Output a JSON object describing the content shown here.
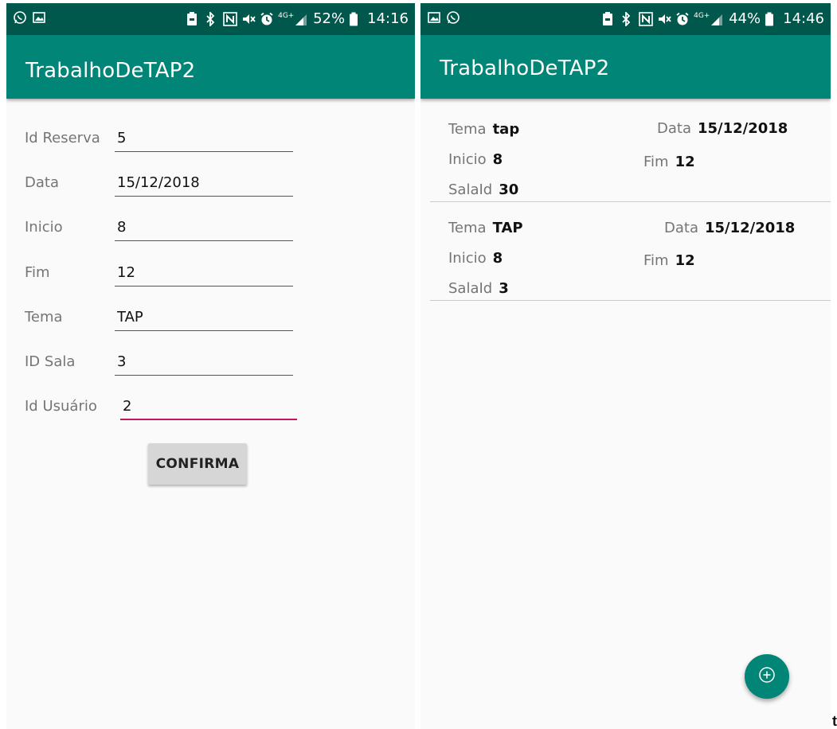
{
  "left_screen": {
    "status_bar": {
      "left_icons": [
        "whatsapp-icon",
        "image-icon"
      ],
      "battery_percent": "52%",
      "time": "14:16"
    },
    "app_title": "TrabalhoDeTAP2",
    "form": {
      "fields": [
        {
          "label": "Id Reserva",
          "value": "5"
        },
        {
          "label": "Data",
          "value": "15/12/2018"
        },
        {
          "label": "Inicio",
          "value": "8"
        },
        {
          "label": "Fim",
          "value": "12"
        },
        {
          "label": "Tema",
          "value": "TAP"
        },
        {
          "label": "ID Sala",
          "value": "3"
        },
        {
          "label": "Id Usuário",
          "value": "2"
        }
      ],
      "confirm_label": "CONFIRMA"
    }
  },
  "right_screen": {
    "status_bar": {
      "left_icons": [
        "image-icon",
        "whatsapp-icon"
      ],
      "battery_percent": "44%",
      "time": "14:46"
    },
    "app_title": "TrabalhoDeTAP2",
    "reservations": [
      {
        "tema_label": "Tema",
        "tema": "tap",
        "data_label": "Data",
        "data": "15/12/2018",
        "inicio_label": "Inicio",
        "inicio": "8",
        "fim_label": "Fim",
        "fim": "12",
        "sala_label": "SalaId",
        "sala": "30"
      },
      {
        "tema_label": "Tema",
        "tema": "TAP",
        "data_label": "Data",
        "data": "15/12/2018",
        "inicio_label": "Inicio",
        "inicio": "8",
        "fim_label": "Fim",
        "fim": "12",
        "sala_label": "SalaId",
        "sala": "3"
      }
    ],
    "fab_icon": "add-circle-icon"
  },
  "status_icons": [
    "battery-saver-icon",
    "bluetooth-icon",
    "nfc-icon",
    "mute-icon",
    "alarm-icon",
    "4g-icon",
    "signal-icon",
    "battery-icon"
  ],
  "network_label": "4G+",
  "colors": {
    "status_bar": "#00574b",
    "app_bar": "#008577",
    "accent": "#c2185b",
    "background": "#fafafa"
  },
  "trailing_glyph": "t"
}
